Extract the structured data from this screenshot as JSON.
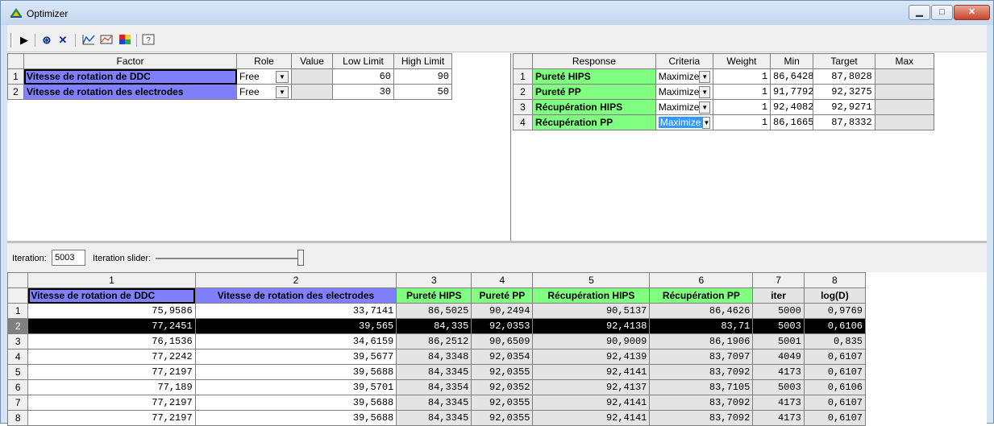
{
  "window": {
    "title": "Optimizer"
  },
  "factors": {
    "headers": [
      "Factor",
      "Role",
      "Value",
      "Low Limit",
      "High Limit"
    ],
    "rows": [
      {
        "n": "1",
        "factor": "Vitesse de rotation de  DDC",
        "role": "Free",
        "value": "",
        "low": "60",
        "high": "90"
      },
      {
        "n": "2",
        "factor": "Vitesse de rotation des electrodes",
        "role": "Free",
        "value": "",
        "low": "30",
        "high": "50"
      }
    ]
  },
  "responses": {
    "headers": [
      "Response",
      "Criteria",
      "Weight",
      "Min",
      "Target",
      "Max"
    ],
    "rows": [
      {
        "n": "1",
        "response": "Pureté HIPS",
        "criteria": "Maximize",
        "weight": "1",
        "min": "86,6428",
        "target": "87,8028",
        "max": ""
      },
      {
        "n": "2",
        "response": "Pureté PP",
        "criteria": "Maximize",
        "weight": "1",
        "min": "91,7792",
        "target": "92,3275",
        "max": ""
      },
      {
        "n": "3",
        "response": "Récupération HIPS",
        "criteria": "Maximize",
        "weight": "1",
        "min": "92,4082",
        "target": "92,9271",
        "max": ""
      },
      {
        "n": "4",
        "response": "Récupération PP",
        "criteria": "Maximize",
        "weight": "1",
        "min": "86,1665",
        "target": "87,8332",
        "max": ""
      }
    ]
  },
  "iteration": {
    "label": "Iteration:",
    "value": "5003",
    "slider_label": "Iteration slider:"
  },
  "results": {
    "col_numbers": [
      "1",
      "2",
      "3",
      "4",
      "5",
      "6",
      "7",
      "8"
    ],
    "col_names": [
      "Vitesse de rotation de  DDC",
      "Vitesse de rotation des electrodes",
      "Pureté HIPS",
      "Pureté PP",
      "Récupération HIPS",
      "Récupération PP",
      "iter",
      "log(D)"
    ],
    "rows": [
      {
        "n": "1",
        "c": [
          "75,9586",
          "33,7141",
          "86,5025",
          "90,2494",
          "90,5137",
          "86,4626",
          "5000",
          "0,9769"
        ]
      },
      {
        "n": "2",
        "c": [
          "77,2451",
          "39,565",
          "84,335",
          "92,0353",
          "92,4138",
          "83,71",
          "5003",
          "0,6106"
        ]
      },
      {
        "n": "3",
        "c": [
          "76,1536",
          "34,6159",
          "86,2512",
          "90,6509",
          "90,9009",
          "86,1906",
          "5001",
          "0,835"
        ]
      },
      {
        "n": "4",
        "c": [
          "77,2242",
          "39,5677",
          "84,3348",
          "92,0354",
          "92,4139",
          "83,7097",
          "4049",
          "0,6107"
        ]
      },
      {
        "n": "5",
        "c": [
          "77,2197",
          "39,5688",
          "84,3345",
          "92,0355",
          "92,4141",
          "83,7092",
          "4173",
          "0,6107"
        ]
      },
      {
        "n": "6",
        "c": [
          "77,189",
          "39,5701",
          "84,3354",
          "92,0352",
          "92,4137",
          "83,7105",
          "5003",
          "0,6106"
        ]
      },
      {
        "n": "7",
        "c": [
          "77,2197",
          "39,5688",
          "84,3345",
          "92,0355",
          "92,4141",
          "83,7092",
          "4173",
          "0,6107"
        ]
      },
      {
        "n": "8",
        "c": [
          "77,2197",
          "39,5688",
          "84,3345",
          "92,0355",
          "92,4141",
          "83,7092",
          "4173",
          "0,6107"
        ]
      }
    ]
  },
  "colors": {
    "factor_bg": "#8080ff",
    "response_bg": "#80ff80",
    "selected_row": "#000000"
  },
  "icons": [
    "run-icon",
    "wheel-icon",
    "cross-icon",
    "plot-icon",
    "surface-icon",
    "color-icon",
    "help-icon"
  ]
}
